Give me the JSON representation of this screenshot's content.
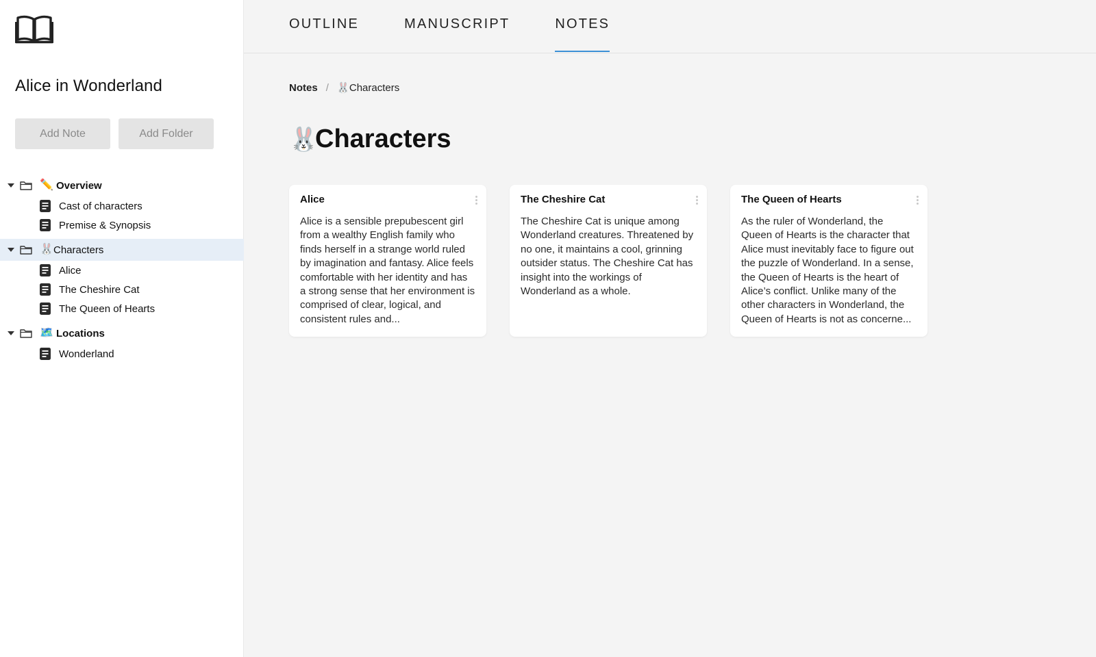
{
  "sidebar": {
    "project_title": "Alice in Wonderland",
    "add_note_label": "Add Note",
    "add_folder_label": "Add Folder",
    "folders": [
      {
        "emoji": "✏️",
        "label": "Overview",
        "items": [
          "Cast of characters",
          "Premise & Synopsis"
        ]
      },
      {
        "emoji": "🐰",
        "label": "Characters",
        "items": [
          "Alice",
          "The Cheshire Cat",
          "The Queen of Hearts"
        ]
      },
      {
        "emoji": "🗺️",
        "label": "Locations",
        "items": [
          "Wonderland"
        ]
      }
    ]
  },
  "tabs": [
    "OUTLINE",
    "MANUSCRIPT",
    "NOTES"
  ],
  "breadcrumb": {
    "root": "Notes",
    "current_emoji": "🐰",
    "current": "Characters"
  },
  "page": {
    "emoji": "🐰",
    "title": "Characters"
  },
  "cards": [
    {
      "title": "Alice",
      "body": "Alice is a sensible prepubescent girl from a wealthy English family who finds herself in a strange world ruled by imagination and fantasy.  Alice feels comfortable with her identity and has a strong sense that her environment is comprised of clear, logical, and consistent rules and..."
    },
    {
      "title": "The Cheshire Cat",
      "body": "The Cheshire Cat is unique among Wonderland creatures. Threatened by no one, it maintains a cool, grinning outsider status.  The Cheshire Cat has insight into the workings of Wonderland as a whole."
    },
    {
      "title": "The Queen of Hearts",
      "body": "As the ruler of Wonderland, the Queen of Hearts is the character that Alice must inevitably face to figure out the puzzle of Wonderland. In a sense, the Queen of Hearts is the heart of Alice’s conflict. Unlike many of the other characters in Wonderland, the Queen of Hearts is not as concerne..."
    }
  ],
  "colors": {
    "accent": "#3b8fd6",
    "selected_row": "#e6eef7",
    "background": "#f4f4f4"
  }
}
